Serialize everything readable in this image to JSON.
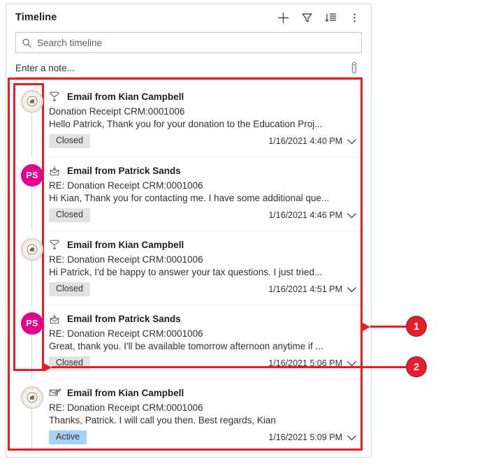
{
  "panel": {
    "title": "Timeline",
    "header_buttons": [
      {
        "name": "add-record-button",
        "icon": "plus-icon",
        "label": "Add"
      },
      {
        "name": "filter-button",
        "icon": "funnel-icon",
        "label": "Filter"
      },
      {
        "name": "sort-button",
        "icon": "sort-descending-icon",
        "label": "Sort"
      },
      {
        "name": "more-commands-button",
        "icon": "more-vertical-icon",
        "label": "More commands"
      }
    ],
    "search": {
      "placeholder": "Search timeline",
      "value": "",
      "icon": "search-icon"
    },
    "note": {
      "placeholder": "Enter a note...",
      "value": "",
      "attach_icon": "paperclip-icon"
    }
  },
  "timeline": {
    "items": [
      {
        "avatar_type": "logo",
        "avatar_initials": "",
        "avatar_color": "#ffffff",
        "type_icon": "email-received-icon",
        "title": "Email from Kian Campbell",
        "subject": "Donation Receipt CRM:0001006",
        "preview": "Hello Patrick,   Thank you for your donation to the Education Proj...",
        "status": "Closed",
        "status_style": "closed",
        "timestamp": "1/16/2021 4:40 PM",
        "chevron_icon": "chevron-down-icon"
      },
      {
        "avatar_type": "initials",
        "avatar_initials": "PS",
        "avatar_color": "#e3008c",
        "type_icon": "email-sent-icon",
        "title": "Email from Patrick Sands",
        "subject": "RE: Donation Receipt CRM:0001006",
        "preview": "Hi Kian, Thank you for contacting me. I have some additional que...",
        "status": "Closed",
        "status_style": "closed",
        "timestamp": "1/16/2021 4:46 PM",
        "chevron_icon": "chevron-down-icon"
      },
      {
        "avatar_type": "logo",
        "avatar_initials": "",
        "avatar_color": "#ffffff",
        "type_icon": "email-received-icon",
        "title": "Email from Kian Campbell",
        "subject": "RE: Donation Receipt CRM:0001006",
        "preview": "Hi Patrick,   I'd be happy to answer your tax questions. I just tried...",
        "status": "Closed",
        "status_style": "closed",
        "timestamp": "1/16/2021 4:51 PM",
        "chevron_icon": "chevron-down-icon"
      },
      {
        "avatar_type": "initials",
        "avatar_initials": "PS",
        "avatar_color": "#e3008c",
        "type_icon": "email-sent-icon",
        "title": "Email from Patrick Sands",
        "subject": "RE: Donation Receipt CRM:0001006",
        "preview": "Great, thank you. I'll be available tomorrow afternoon anytime if ...",
        "status": "Closed",
        "status_style": "closed",
        "timestamp": "1/16/2021 5:06 PM",
        "chevron_icon": "chevron-down-icon"
      },
      {
        "avatar_type": "logo",
        "avatar_initials": "",
        "avatar_color": "#ffffff",
        "type_icon": "email-draft-icon",
        "title": "Email from Kian Campbell",
        "subject": "RE: Donation Receipt CRM:0001006",
        "preview": "Thanks, Patrick. I will call you then.   Best regards, Kian",
        "status": "Active",
        "status_style": "active",
        "timestamp": "1/16/2021 5:09 PM",
        "chevron_icon": "chevron-down-icon"
      }
    ]
  },
  "annotations": {
    "color": "#ee1b24",
    "badge_border_color": "#2b3f8c",
    "markers": [
      {
        "label": "1"
      },
      {
        "label": "2"
      }
    ]
  }
}
